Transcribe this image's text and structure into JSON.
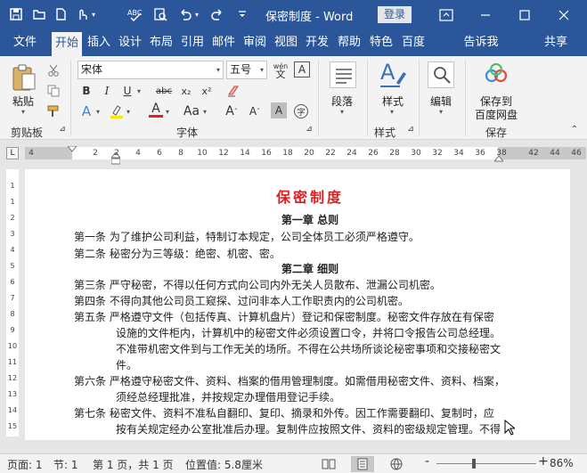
{
  "title_bar": {
    "doc_title": "保密制度 - Word",
    "login_label": "登录"
  },
  "tabs": [
    {
      "label": "文件"
    },
    {
      "label": "开始",
      "active": true
    },
    {
      "label": "插入"
    },
    {
      "label": "设计"
    },
    {
      "label": "布局"
    },
    {
      "label": "引用"
    },
    {
      "label": "邮件"
    },
    {
      "label": "审阅"
    },
    {
      "label": "视图"
    },
    {
      "label": "开发"
    },
    {
      "label": "帮助"
    },
    {
      "label": "特色"
    },
    {
      "label": "百度"
    },
    {
      "label": "告诉我"
    },
    {
      "label": "共享"
    }
  ],
  "ribbon": {
    "clipboard": {
      "paste_label": "粘贴",
      "group_label": "剪贴板"
    },
    "font": {
      "font_name": "宋体",
      "font_size": "五号",
      "wen_label": "wén",
      "group_label": "字体"
    },
    "paragraph": {
      "label": "段落"
    },
    "styles": {
      "label": "样式",
      "group_label": "样式"
    },
    "editing": {
      "label": "编辑"
    },
    "save": {
      "line1": "保存到",
      "line2": "百度网盘",
      "group_label": "保存"
    }
  },
  "ruler": {
    "numbers": [
      "4",
      "2",
      "2",
      "4",
      "6",
      "8",
      "10",
      "12",
      "14",
      "16",
      "18",
      "20",
      "22",
      "24",
      "26",
      "28",
      "30",
      "32",
      "34",
      "36",
      "38",
      "42",
      "44",
      "46"
    ],
    "vertical_numbers": [
      "1",
      "1",
      "2",
      "3",
      "4",
      "5",
      "6",
      "7",
      "8",
      "9",
      "10",
      "11",
      "12",
      "13",
      "14",
      "15"
    ]
  },
  "document": {
    "heading": "保密制度",
    "chapter1": "第一章  总则",
    "chapter2": "第二章  细则",
    "lines": [
      "第一条  为了维护公司利益，特制订本规定，公司全体员工必须严格遵守。",
      "第二条  秘密分为三等级：绝密、机密、密。",
      "第三条  严守秘密，不得以任何方式向公司内外无关人员散布、泄漏公司机密。",
      "第四条  不得向其他公司员工窥探、过问非本人工作职责内的公司机密。",
      "第五条  严格遵守文件（包括传真、计算机盘片）登记和保密制度。秘密文件存放在有保密",
      "设施的文件柜内，计算机中的秘密文件必须设置口令，并将口令报告公司总经理。",
      "不准带机密文件到与工作无关的场所。不得在公共场所谈论秘密事项和交接秘密文",
      "件。",
      "第六条  严格遵守秘密文件、资料、档案的借用管理制度。如需借用秘密文件、资料、档案，",
      "须经总经理批准，并按规定办理借用登记手续。",
      "第七条  秘密文件、资料不准私自翻印、复印、摘录和外传。因工作需要翻印、复制时，应",
      "按有关规定经办公室批准后办理。复制件应按照文件、资料的密级规定管理。不得"
    ]
  },
  "status": {
    "page": "页面: 1",
    "section": "节: 1",
    "page_of": "第 1 页，共 1 页",
    "position": "位置值: 5.8厘米",
    "zoom": "86%",
    "minus": "-",
    "plus": "+"
  },
  "colors": {
    "brand": "#2b579a",
    "heading_red": "#e02020"
  }
}
